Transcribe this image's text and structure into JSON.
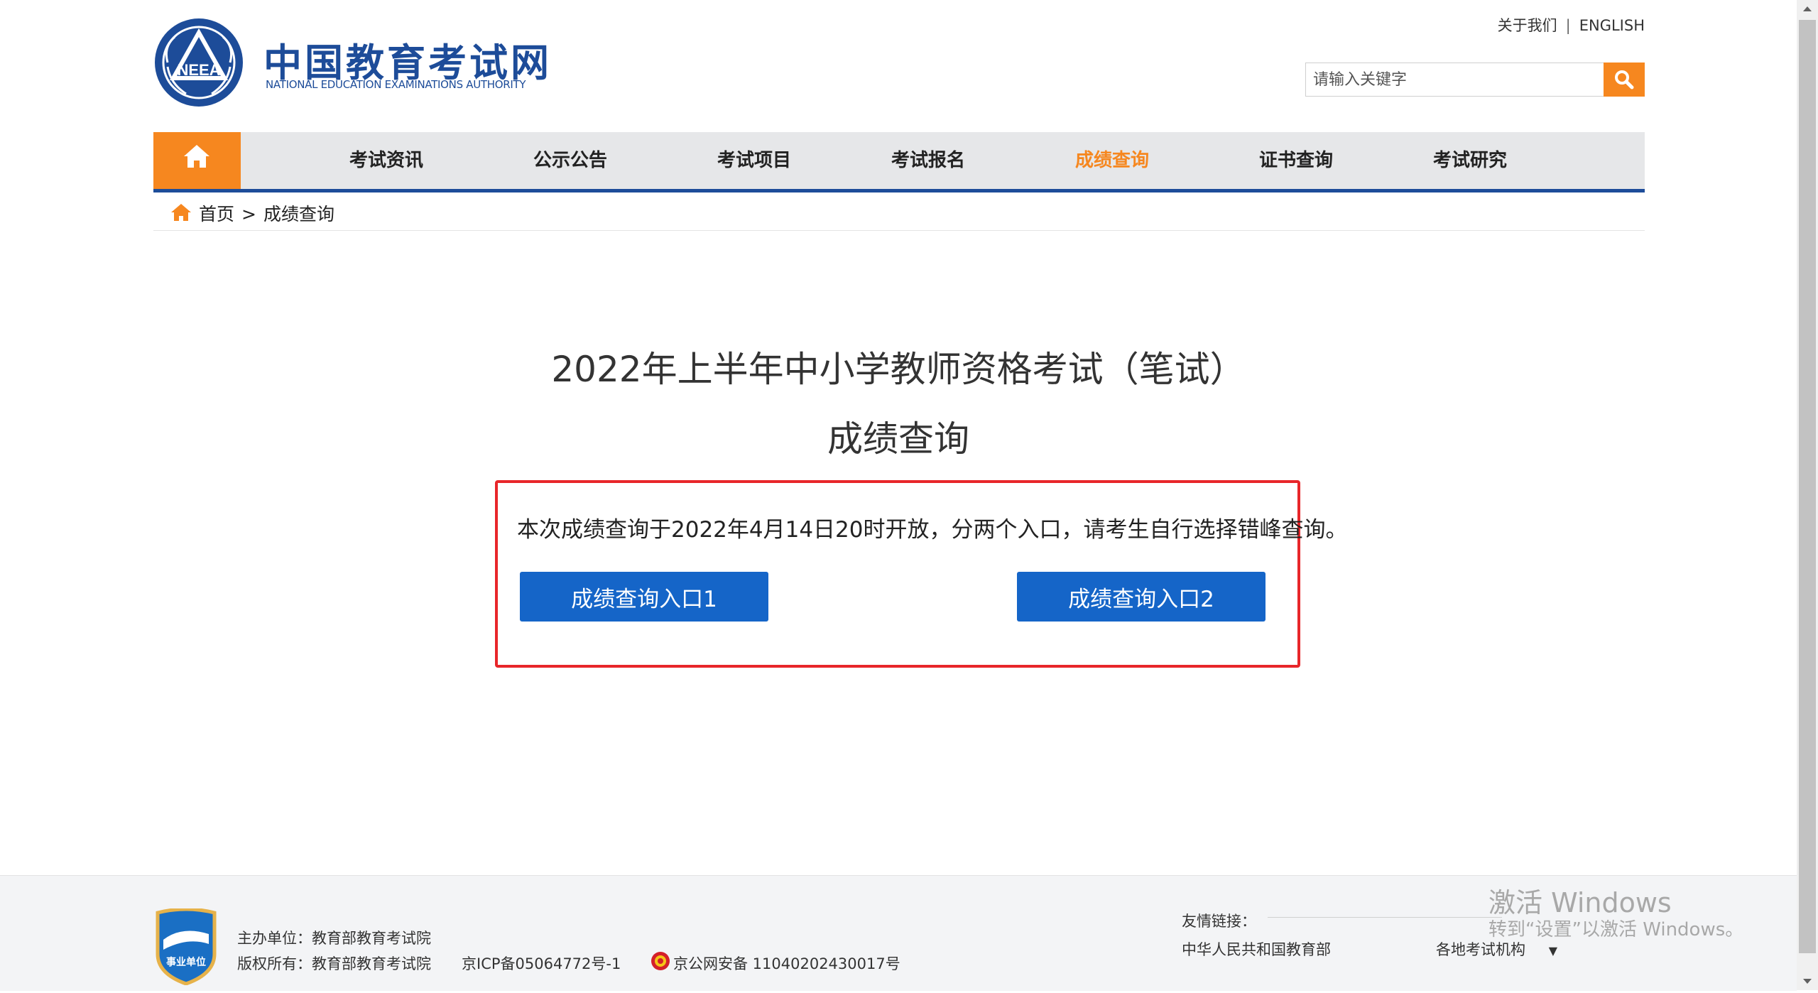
{
  "header": {
    "logo_cn": "中国教育考试网",
    "logo_en": "NATIONAL EDUCATION EXAMINATIONS AUTHORITY",
    "emblem_text": "NEEA",
    "about_link": "关于我们",
    "separator": "|",
    "english_link": "ENGLISH",
    "search_placeholder": "请输入关键字"
  },
  "nav": {
    "items": [
      {
        "label": "考试资讯"
      },
      {
        "label": "公示公告"
      },
      {
        "label": "考试项目"
      },
      {
        "label": "考试报名"
      },
      {
        "label": "成绩查询",
        "active": true
      },
      {
        "label": "证书查询"
      },
      {
        "label": "考试研究"
      }
    ]
  },
  "breadcrumb": {
    "home": "首页",
    "arrow": ">",
    "current": "成绩查询"
  },
  "main": {
    "title_line1": "2022年上半年中小学教师资格考试（笔试）",
    "title_line2": "成绩查询",
    "notice": "本次成绩查询于2022年4月14日20时开放，分两个入口，请考生自行选择错峰查询。",
    "entry1": "成绩查询入口1",
    "entry2": "成绩查询入口2"
  },
  "footer": {
    "badge_text": "事业单位",
    "sponsor": "主办单位：教育部教育考试院",
    "copyright": "版权所有：教育部教育考试院",
    "icp": "京ICP备05064772号-1",
    "police": "京公网安备 11040202430017号",
    "links_label": "友情链接：",
    "link_moe": "中华人民共和国教育部",
    "link_local": "各地考试机构",
    "dropdown_arrow": "▼"
  },
  "watermark": {
    "line1": "激活 Windows",
    "line2": "转到“设置”以激活 Windows。"
  },
  "colors": {
    "brand_blue": "#1d4c99",
    "accent_orange": "#f6871f",
    "button_blue": "#1565c8",
    "notice_border": "#e8262a"
  }
}
